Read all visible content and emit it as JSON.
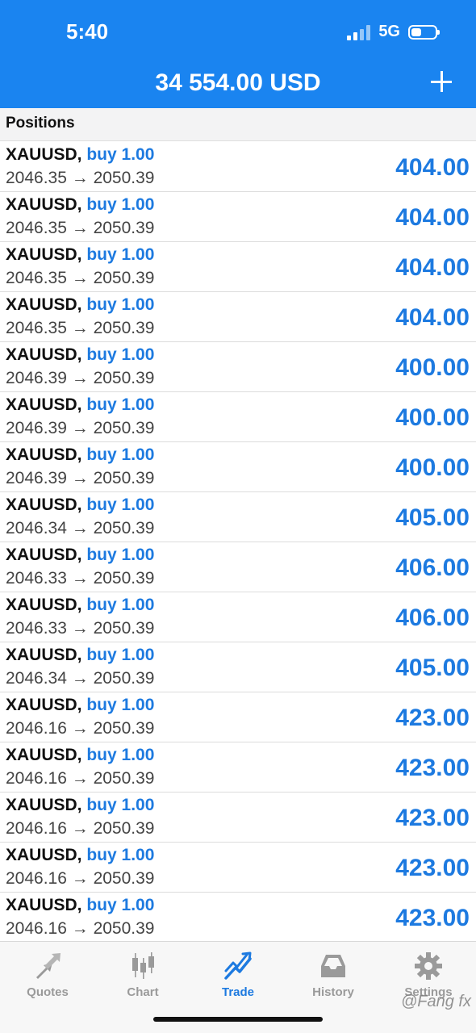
{
  "status_bar": {
    "time": "5:40",
    "network": "5G"
  },
  "header": {
    "balance": "34 554.00 USD"
  },
  "positions": {
    "title": "Positions",
    "rows": [
      {
        "symbol": "XAUUSD,",
        "side": "buy 1.00",
        "prices": "2046.35 → 2050.39",
        "profit": "404.00"
      },
      {
        "symbol": "XAUUSD,",
        "side": "buy 1.00",
        "prices": "2046.35 → 2050.39",
        "profit": "404.00"
      },
      {
        "symbol": "XAUUSD,",
        "side": "buy 1.00",
        "prices": "2046.35 → 2050.39",
        "profit": "404.00"
      },
      {
        "symbol": "XAUUSD,",
        "side": "buy 1.00",
        "prices": "2046.35 → 2050.39",
        "profit": "404.00"
      },
      {
        "symbol": "XAUUSD,",
        "side": "buy 1.00",
        "prices": "2046.39 → 2050.39",
        "profit": "400.00"
      },
      {
        "symbol": "XAUUSD,",
        "side": "buy 1.00",
        "prices": "2046.39 → 2050.39",
        "profit": "400.00"
      },
      {
        "symbol": "XAUUSD,",
        "side": "buy 1.00",
        "prices": "2046.39 → 2050.39",
        "profit": "400.00"
      },
      {
        "symbol": "XAUUSD,",
        "side": "buy 1.00",
        "prices": "2046.34 → 2050.39",
        "profit": "405.00"
      },
      {
        "symbol": "XAUUSD,",
        "side": "buy 1.00",
        "prices": "2046.33 → 2050.39",
        "profit": "406.00"
      },
      {
        "symbol": "XAUUSD,",
        "side": "buy 1.00",
        "prices": "2046.33 → 2050.39",
        "profit": "406.00"
      },
      {
        "symbol": "XAUUSD,",
        "side": "buy 1.00",
        "prices": "2046.34 → 2050.39",
        "profit": "405.00"
      },
      {
        "symbol": "XAUUSD,",
        "side": "buy 1.00",
        "prices": "2046.16 → 2050.39",
        "profit": "423.00"
      },
      {
        "symbol": "XAUUSD,",
        "side": "buy 1.00",
        "prices": "2046.16 → 2050.39",
        "profit": "423.00"
      },
      {
        "symbol": "XAUUSD,",
        "side": "buy 1.00",
        "prices": "2046.16 → 2050.39",
        "profit": "423.00"
      },
      {
        "symbol": "XAUUSD,",
        "side": "buy 1.00",
        "prices": "2046.16 → 2050.39",
        "profit": "423.00"
      },
      {
        "symbol": "XAUUSD,",
        "side": "buy 1.00",
        "prices": "2046.16 → 2050.39",
        "profit": "423.00"
      }
    ]
  },
  "tabbar": {
    "tabs": [
      {
        "label": "Quotes",
        "icon": "quotes-arrows-icon"
      },
      {
        "label": "Chart",
        "icon": "candlestick-icon"
      },
      {
        "label": "Trade",
        "icon": "trade-trend-icon",
        "active": true
      },
      {
        "label": "History",
        "icon": "history-inbox-icon"
      },
      {
        "label": "Settings",
        "icon": "gear-icon"
      }
    ]
  },
  "watermark": "@Fang fx",
  "colors": {
    "header_bg": "#1a84f0",
    "accent": "#1d7ae0",
    "inactive": "#9a9a9a"
  }
}
